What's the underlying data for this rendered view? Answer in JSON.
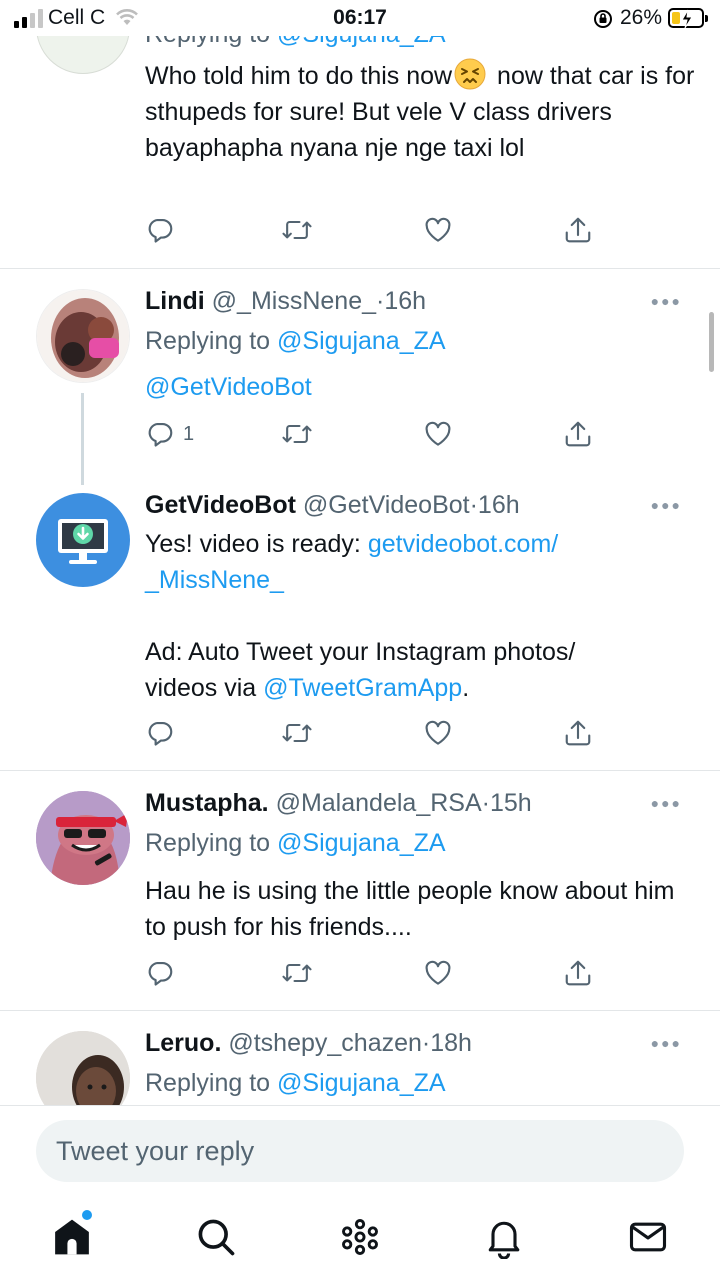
{
  "status_bar": {
    "carrier": "Cell C",
    "time": "06:17",
    "battery_percent": "26%"
  },
  "tweets": [
    {
      "reply_to_label": "Replying to",
      "reply_to_handle": "@Sigujana_ZA",
      "text_part1": "Who told him to do this now",
      "emoji": "persevering-face",
      "text_part2": " now that car is for sthupeds for sure! But vele V class drivers bayaphapha nyana nje nge taxi lol",
      "reply_count": ""
    },
    {
      "name": "Lindi",
      "handle": "@_MissNene_",
      "dot": "·",
      "time": "16h",
      "reply_to_label": "Replying to",
      "reply_to_handle": "@Sigujana_ZA",
      "text": "@GetVideoBot",
      "reply_count": "1"
    },
    {
      "name": "GetVideoBot",
      "handle": "@GetVideoBot",
      "dot": "·",
      "time": "16h",
      "text_intro": "Yes! video is ready: ",
      "link": "getvideobot.com/\n_MissNene_",
      "text_ad": "Ad: Auto Tweet your Instagram photos/\nvideos via ",
      "ad_mention": "@TweetGramApp",
      "ad_end": ".",
      "reply_count": ""
    },
    {
      "name": "Mustapha.",
      "handle": "@Malandela_RSA",
      "dot": "·",
      "time": "15h",
      "reply_to_label": "Replying to",
      "reply_to_handle": "@Sigujana_ZA",
      "text": "Hau he is using the little people know about him to push for his friends....",
      "reply_count": ""
    },
    {
      "name": "Leruo.",
      "handle": "@tshepy_chazen",
      "dot": "·",
      "time": "18h",
      "reply_to_label": "Replying to",
      "reply_to_handle": "@Sigujana_ZA"
    }
  ],
  "compose": {
    "placeholder": "Tweet your reply"
  },
  "tabbar": {
    "items": [
      "home-icon",
      "search-icon",
      "spaces-icon",
      "notifications-icon",
      "messages-icon"
    ],
    "active": "home-icon",
    "home_has_new": true
  },
  "colors": {
    "accent": "#1d9bf0",
    "text": "#0f1419",
    "muted": "#536471",
    "divider": "#e3e6e8"
  }
}
